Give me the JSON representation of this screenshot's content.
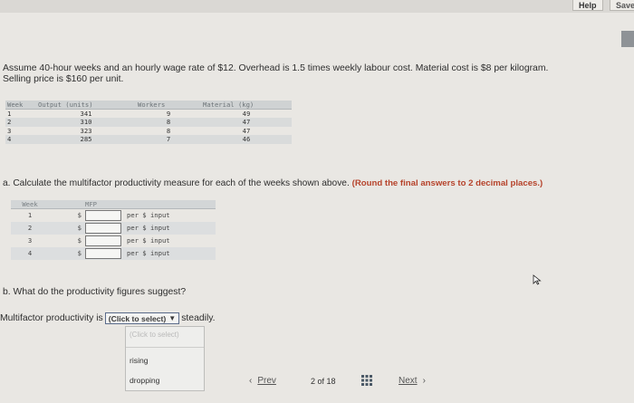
{
  "topbar": {
    "help_label": "Help",
    "save_label": "Save"
  },
  "problem": {
    "line1": "Assume 40-hour weeks and an hourly wage rate of $12. Overhead is 1.5 times weekly labour cost. Material cost is $8 per kilogram.",
    "line2": "Selling price is $160 per unit."
  },
  "data_table": {
    "headers": [
      "Week",
      "Output (units)",
      "Workers",
      "Material (kg)"
    ],
    "rows": [
      [
        "1",
        "341",
        "9",
        "49"
      ],
      [
        "2",
        "310",
        "8",
        "47"
      ],
      [
        "3",
        "323",
        "8",
        "47"
      ],
      [
        "4",
        "285",
        "7",
        "46"
      ]
    ]
  },
  "question_a": {
    "text": "a. Calculate the multifactor productivity measure for each of the weeks shown above.",
    "note": "(Round the final answers to 2 decimal places.)"
  },
  "mfp_table": {
    "headers": [
      "Week",
      "",
      "MFP",
      ""
    ],
    "rows": [
      {
        "week": "1",
        "dollar": "$",
        "value": "",
        "unit": "per $ input"
      },
      {
        "week": "2",
        "dollar": "$",
        "value": "",
        "unit": "per $ input"
      },
      {
        "week": "3",
        "dollar": "$",
        "value": "",
        "unit": "per $ input"
      },
      {
        "week": "4",
        "dollar": "$",
        "value": "",
        "unit": "per $ input"
      }
    ]
  },
  "question_b": {
    "text": "b. What do the productivity figures suggest?"
  },
  "multifactor_line": {
    "prefix": "Multifactor productivity is",
    "select_value": "(Click to select)",
    "suffix": "steadily."
  },
  "dropdown": {
    "placeholder": "(Click to select)",
    "options": [
      "rising",
      "dropping"
    ]
  },
  "pager": {
    "prev_label": "Prev",
    "page_text": "2 of 18",
    "next_label": "Next"
  },
  "icons": {
    "prev": "chevron-left-icon",
    "next": "chevron-right-icon",
    "grid": "grid-icon",
    "dropdown": "chevron-down-icon"
  },
  "colors": {
    "note_red": "#b6432b",
    "select_border": "#5a6b8a"
  }
}
